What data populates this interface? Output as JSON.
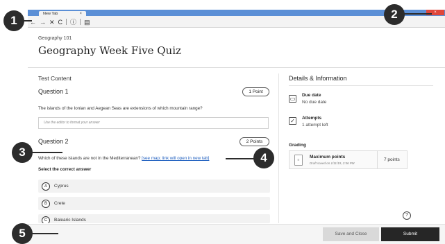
{
  "browser": {
    "tab_title": "New Tab",
    "tab_close": "×",
    "window_close": "×",
    "nav": {
      "back": "←",
      "forward": "→",
      "stop": "✕",
      "reload": "C",
      "info": "ⓘ",
      "reader": "▤"
    }
  },
  "callouts": [
    "1",
    "2",
    "3",
    "4",
    "5"
  ],
  "header": {
    "course": "Geography 101",
    "title": "Geography Week Five Quiz"
  },
  "content": {
    "section_label": "Test Content",
    "question1": {
      "title": "Question 1",
      "points": "1 Point",
      "text": "The islands of the Ionian and Aegean Seas are extensions of which mountain range?",
      "editor_placeholder": "Use the editor to format your answer"
    },
    "question2": {
      "title": "Question 2",
      "points": "2 Points",
      "text": "Which of these islands are not in the Mediterranean?",
      "link": "[see map; link will open in new tab]",
      "select_label": "Select the correct answer",
      "options": [
        {
          "letter": "A",
          "text": "Cyprus"
        },
        {
          "letter": "B",
          "text": "Crete"
        },
        {
          "letter": "C",
          "text": "Balearic Islands"
        }
      ]
    }
  },
  "details": {
    "title": "Details & Information",
    "due_label": "Due date",
    "due_value": "No due date",
    "attempts_label": "Attempts",
    "attempts_value": "1 attempt left",
    "grading_label": "Grading",
    "max_points_label": "Maximum points",
    "draft_saved": "Draft saved on 1/11/19, 2:56 PM",
    "points_value": "7 points",
    "help": "?"
  },
  "footer": {
    "save_label": "Save and Close",
    "submit_label": "Submit"
  }
}
